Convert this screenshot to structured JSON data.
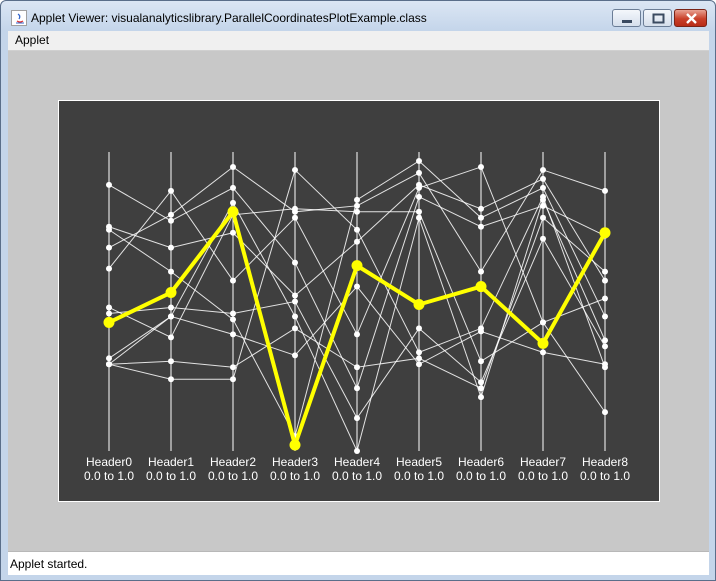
{
  "window": {
    "title": "Applet Viewer: visualanalyticslibrary.ParallelCoordinatesPlotExample.class",
    "icon": "java-applet-icon",
    "controls": [
      "minimize-icon",
      "maximize-icon",
      "close-icon"
    ]
  },
  "menu": {
    "items": [
      "Applet"
    ]
  },
  "status": {
    "text": "Applet started."
  },
  "colors": {
    "background": "#3f3f3f",
    "axis": "#ffffff",
    "line": "#ffffff",
    "highlight": "#ffff00",
    "frame": "#c8c8c8"
  },
  "chart_data": {
    "type": "parallel-coordinates",
    "axes": [
      {
        "name": "Header0",
        "range": "0.0 to 1.0"
      },
      {
        "name": "Header1",
        "range": "0.0 to 1.0"
      },
      {
        "name": "Header2",
        "range": "0.0 to 1.0"
      },
      {
        "name": "Header3",
        "range": "0.0 to 1.0"
      },
      {
        "name": "Header4",
        "range": "0.0 to 1.0"
      },
      {
        "name": "Header5",
        "range": "0.0 to 1.0"
      },
      {
        "name": "Header6",
        "range": "0.0 to 1.0"
      },
      {
        "name": "Header7",
        "range": "0.0 to 1.0"
      },
      {
        "name": "Header8",
        "range": "0.0 to 1.0"
      }
    ],
    "ylim": [
      0,
      1
    ],
    "highlighted": [
      0.43,
      0.53,
      0.8,
      0.02,
      0.62,
      0.49,
      0.55,
      0.36,
      0.73
    ],
    "records": [
      [
        0.89,
        0.77,
        0.88,
        0.63,
        0.21,
        0.85,
        0.75,
        0.82,
        0.72
      ],
      [
        0.75,
        0.68,
        0.73,
        0.52,
        0.7,
        0.89,
        0.81,
        0.91,
        0.57
      ],
      [
        0.68,
        0.79,
        0.95,
        0.8,
        0.82,
        0.93,
        0.6,
        0.94,
        0.87
      ],
      [
        0.74,
        0.6,
        0.44,
        0.05,
        0.84,
        0.97,
        0.78,
        0.88,
        0.45
      ],
      [
        0.61,
        0.87,
        0.57,
        0.78,
        0.39,
        0.88,
        0.95,
        0.43,
        0.51
      ],
      [
        0.46,
        0.48,
        0.46,
        0.5,
        0.11,
        0.41,
        0.23,
        0.71,
        0.35
      ],
      [
        0.48,
        0.38,
        0.79,
        0.81,
        0.8,
        0.8,
        0.3,
        0.43,
        0.13
      ],
      [
        0.31,
        0.45,
        0.39,
        0.32,
        0.55,
        0.29,
        0.4,
        0.33,
        0.29
      ],
      [
        0.29,
        0.24,
        0.24,
        0.94,
        0.74,
        0.33,
        0.41,
        0.85,
        0.28
      ],
      [
        0.29,
        0.3,
        0.28,
        0.41,
        0.28,
        0.31,
        0.21,
        0.78,
        0.6
      ],
      [
        0.29,
        0.45,
        0.83,
        0.45,
        0.0,
        0.78,
        0.18,
        0.84,
        0.37
      ]
    ]
  }
}
